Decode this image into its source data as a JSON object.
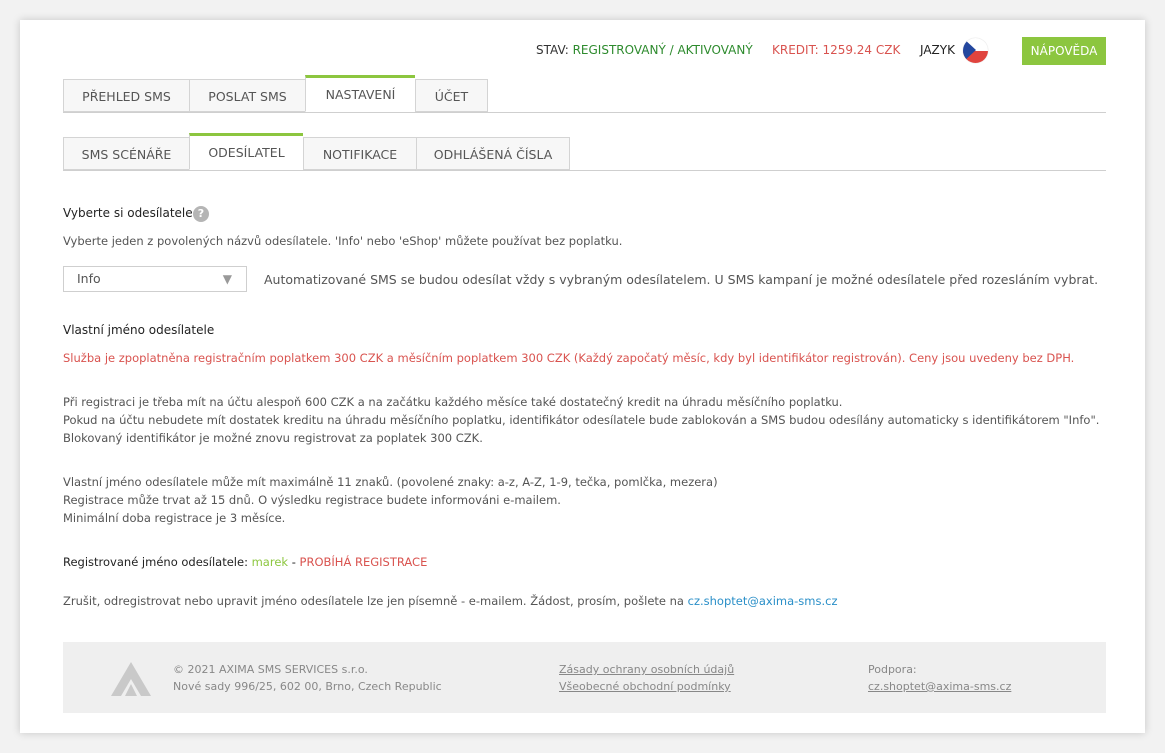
{
  "header": {
    "status_label": "STAV:",
    "status_value": "REGISTROVANÝ / AKTIVOVANÝ",
    "credit": "KREDIT: 1259.24 CZK",
    "language_label": "JAZYK",
    "help_button": "NÁPOVĚDA"
  },
  "main_tabs": [
    {
      "label": "PŘEHLED SMS"
    },
    {
      "label": "POSLAT SMS"
    },
    {
      "label": "NASTAVENÍ"
    },
    {
      "label": "ÚČET"
    }
  ],
  "sub_tabs": [
    {
      "label": "SMS SCÉNÁŘE"
    },
    {
      "label": "ODESÍLATEL"
    },
    {
      "label": "NOTIFIKACE"
    },
    {
      "label": "ODHLÁŠENÁ ČÍSLA"
    }
  ],
  "sender": {
    "heading": "Vyberte si odesílatele",
    "help_icon": "?",
    "intro": "Vyberte jeden z povolených názvů odesílatele. 'Info' nebo 'eShop' můžete používat bez poplatku.",
    "select_value": "Info",
    "select_arrow": "▼",
    "select_note": "Automatizované SMS se budou odesílat vždy s vybraným odesílatelem. U SMS kampaní je možné odesílatele před rozesláním vybrat."
  },
  "custom": {
    "heading": "Vlastní jméno odesílatele",
    "fee_notice": "Služba je zpoplatněna registračním poplatkem 300 CZK a měsíčním poplatkem 300 CZK (Každý započatý měsíc, kdy byl identifikátor registrován). Ceny jsou uvedeny bez DPH.",
    "para1": [
      "Při registraci je třeba mít na účtu alespoň 600 CZK a na začátku každého měsíce také dostatečný kredit na úhradu měsíčního poplatku.",
      "Pokud na účtu nebudete mít dostatek kreditu na úhradu měsíčního poplatku, identifikátor odesílatele bude zablokován a SMS budou odesílány automaticky s identifikátorem \"Info\".",
      "Blokovaný identifikátor je možné znovu registrovat za poplatek 300 CZK."
    ],
    "para2": [
      "Vlastní jméno odesílatele může mít maximálně 11 znaků. (povolené znaky: a-z, A-Z, 1-9, tečka, pomlčka, mezera)",
      "Registrace může trvat až 15 dnů. O výsledku registrace budete informováni e-mailem.",
      "Minimální doba registrace je 3 měsíce."
    ],
    "registered_label": "Registrované jméno odesílatele:",
    "registered_name": "marek",
    "registered_sep": " - ",
    "registered_status": "PROBÍHÁ REGISTRACE",
    "cancel_text": "Zrušit, odregistrovat nebo upravit jméno odesílatele lze jen písemně - e-mailem. Žádost, prosím, pošlete na ",
    "cancel_email": "cz.shoptet@axima-sms.cz"
  },
  "footer": {
    "copyright": "© 2021 AXIMA SMS SERVICES s.r.o.",
    "address": "Nové sady 996/25, 602 00, Brno, Czech Republic",
    "privacy_link": "Zásady ochrany osobních údajů",
    "terms_link": "Všeobecné obchodní podmínky",
    "support_label": "Podpora:",
    "support_email": "cz.shoptet@axima-sms.cz"
  },
  "colors": {
    "accent": "#8cc63f",
    "danger": "#d9534f",
    "status_green": "#2e8b2e",
    "link": "#2a8fc8"
  }
}
